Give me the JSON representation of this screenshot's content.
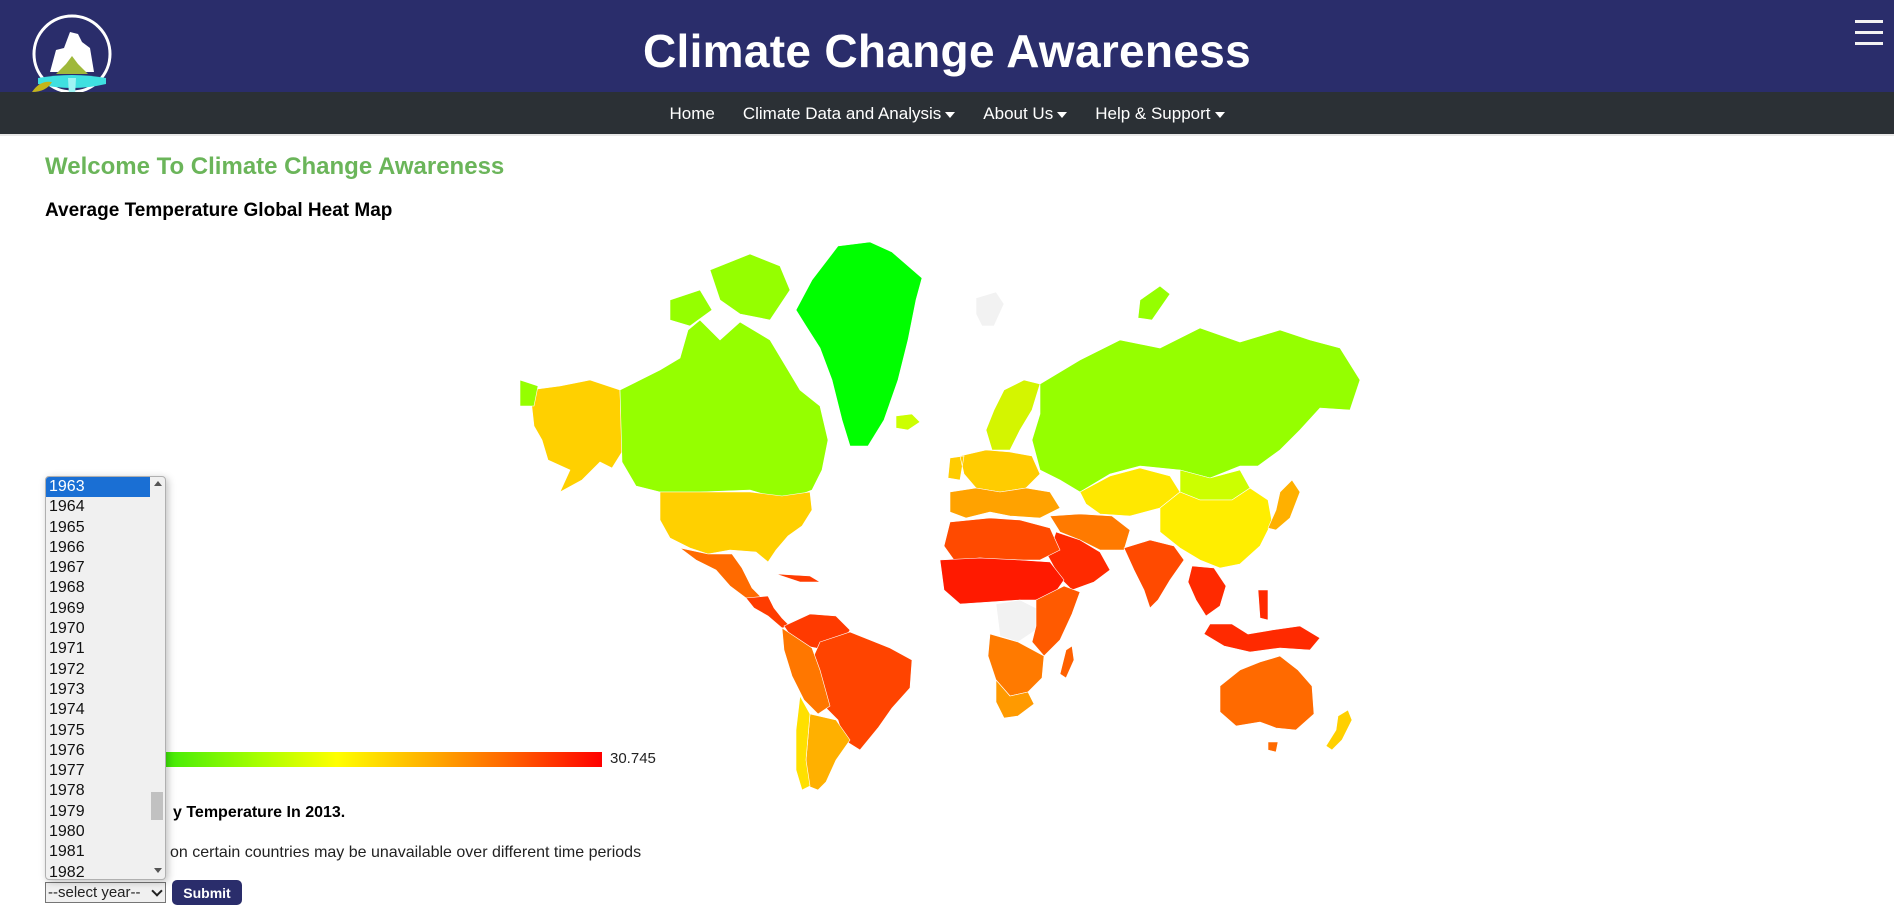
{
  "header": {
    "title": "Climate Change Awareness",
    "logo_icon": "mountain-waterfall-logo-icon",
    "menu_icon": "hamburger-menu-icon"
  },
  "nav": {
    "items": [
      {
        "label": "Home",
        "has_dropdown": false
      },
      {
        "label": "Climate Data and Analysis",
        "has_dropdown": true
      },
      {
        "label": "About Us",
        "has_dropdown": true
      },
      {
        "label": "Help & Support",
        "has_dropdown": true
      }
    ]
  },
  "main": {
    "welcome": "Welcome To Climate Change Awareness",
    "map_heading": "Average Temperature Global Heat Map",
    "legend": {
      "max_value": "30.745",
      "colors": [
        "#00ff00",
        "#ffff00",
        "#ff0000"
      ]
    },
    "info_heading_visible": "y Temperature In 2013.",
    "note_visible": "on certain countries may be unavailable over different time periods",
    "year_select": {
      "placeholder": "--select year--",
      "highlighted": "1963",
      "visible_options": [
        "1963",
        "1964",
        "1965",
        "1966",
        "1967",
        "1968",
        "1969",
        "1970",
        "1971",
        "1972",
        "1973",
        "1974",
        "1975",
        "1976",
        "1977",
        "1978",
        "1979",
        "1980",
        "1981",
        "1982"
      ]
    },
    "submit_label": "Submit"
  },
  "map": {
    "year": "2013",
    "regions": [
      {
        "name": "Greenland",
        "color": "#00ff00"
      },
      {
        "name": "Canada",
        "color": "#95ff00"
      },
      {
        "name": "Alaska",
        "color": "#ffd000"
      },
      {
        "name": "United States",
        "color": "#ffd000"
      },
      {
        "name": "Mexico",
        "color": "#ff6a00"
      },
      {
        "name": "Central America",
        "color": "#ff3c00"
      },
      {
        "name": "Brazil",
        "color": "#ff4400"
      },
      {
        "name": "Northern South America",
        "color": "#ff3a00"
      },
      {
        "name": "Peru Bolivia",
        "color": "#ff7700"
      },
      {
        "name": "Argentina",
        "color": "#ffb000"
      },
      {
        "name": "Chile",
        "color": "#ffe000"
      },
      {
        "name": "Iceland",
        "color": "#ccff00"
      },
      {
        "name": "Scandinavia",
        "color": "#d4f500"
      },
      {
        "name": "Western Europe",
        "color": "#ffcc00"
      },
      {
        "name": "Southern Europe",
        "color": "#ffa200"
      },
      {
        "name": "Russia",
        "color": "#95ff00"
      },
      {
        "name": "Kazakhstan",
        "color": "#ffe800"
      },
      {
        "name": "Mongolia",
        "color": "#ccff00"
      },
      {
        "name": "China",
        "color": "#ffee00"
      },
      {
        "name": "Middle East",
        "color": "#ff7a00"
      },
      {
        "name": "Arabia",
        "color": "#ff2a00"
      },
      {
        "name": "North Africa",
        "color": "#ff4a00"
      },
      {
        "name": "Sahel",
        "color": "#ff1a00"
      },
      {
        "name": "Central Africa",
        "color": "#f2f2f2"
      },
      {
        "name": "East Africa",
        "color": "#ff5a00"
      },
      {
        "name": "Southern Africa",
        "color": "#ff7a00"
      },
      {
        "name": "South Africa",
        "color": "#ff9a00"
      },
      {
        "name": "Madagascar",
        "color": "#ff6000"
      },
      {
        "name": "India",
        "color": "#ff4a00"
      },
      {
        "name": "Southeast Asia",
        "color": "#ff2a00"
      },
      {
        "name": "Indonesia",
        "color": "#ff2a00"
      },
      {
        "name": "Japan",
        "color": "#ffb000"
      },
      {
        "name": "Australia",
        "color": "#ff6a00"
      },
      {
        "name": "New Zealand",
        "color": "#ffd000"
      },
      {
        "name": "Svalbard",
        "color": "#f2f2f2"
      }
    ]
  }
}
